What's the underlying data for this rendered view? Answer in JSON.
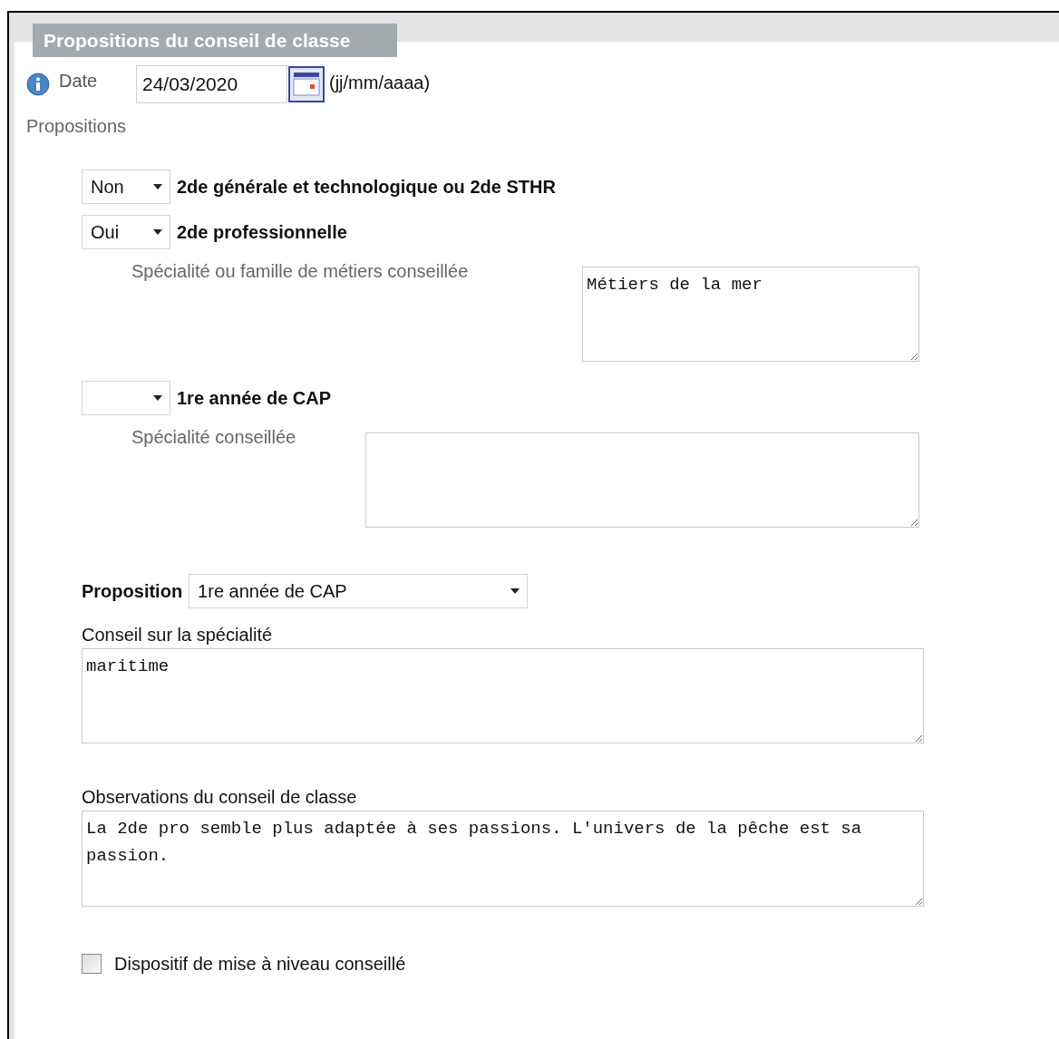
{
  "section": {
    "title": "Propositions du conseil de classe"
  },
  "date": {
    "label": "Date",
    "value": "24/03/2020",
    "format_hint": "(jj/mm/aaaa)"
  },
  "propositions_label": "Propositions",
  "options": [
    {
      "answer": "Non",
      "label": "2de générale et technologique ou 2de STHR"
    },
    {
      "answer": "Oui",
      "label": "2de professionnelle",
      "detail": {
        "label": "Spécialité ou famille de métiers conseillée",
        "value": "Métiers de la mer"
      }
    },
    {
      "label": "1re année de CAP",
      "detail": {
        "label": "Spécialité conseillée"
      }
    }
  ],
  "proposition": {
    "label": "Proposition",
    "value": "1re année de CAP"
  },
  "advice": {
    "label": "Conseil sur la spécialité",
    "value": "maritime"
  },
  "observations": {
    "label": "Observations du conseil de classe",
    "value": "La 2de pro semble plus adaptée à ses passions. L'univers de la pêche est sa passion."
  },
  "remediation": {
    "label": "Dispositif de mise à niveau conseillé",
    "checked": false
  }
}
